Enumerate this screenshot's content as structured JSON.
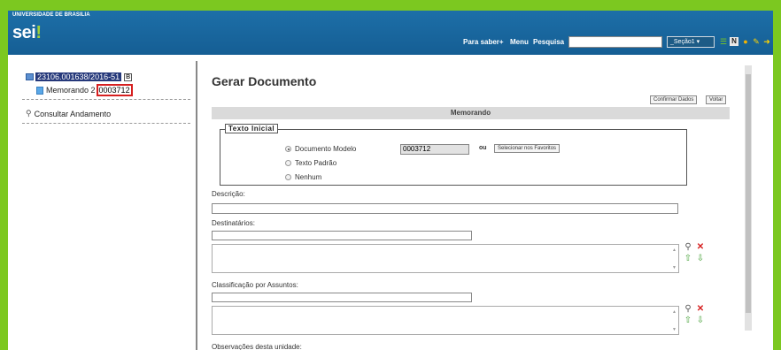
{
  "header": {
    "institution": "UNIVERSIDADE DE BRASILIA",
    "logo_text": "sei",
    "logo_dot": "!",
    "nav": [
      "Para saber+",
      "Menu",
      "Pesquisa"
    ],
    "search_value": "",
    "unit_select": "_Seção1",
    "icons": [
      "list-icon",
      "notification-icon",
      "user-icon",
      "tools-icon",
      "exit-icon"
    ]
  },
  "tree": {
    "process_number": "23106.001638/2016-51",
    "process_badge": "B",
    "document_label": "Memorando 2",
    "document_number": "0003712",
    "consult_label": "Consultar Andamento"
  },
  "page": {
    "title": "Gerar Documento",
    "confirm_button": "Confirmar Dados",
    "back_button": "Voltar",
    "section_title": "Memorando"
  },
  "initial_text": {
    "legend": "Texto Inicial",
    "options": [
      "Documento Modelo",
      "Texto Padrão",
      "Nenhum"
    ],
    "selected": "Documento Modelo",
    "model_value": "0003712",
    "or_label": "ou",
    "favorites_button": "Selecionar nos Favoritos"
  },
  "fields": {
    "description_label": "Descrição:",
    "description_value": "",
    "recipients_label": "Destinatários:",
    "subjects_label": "Classificação por Assuntos:",
    "notes_label": "Observações desta unidade:"
  },
  "colors": {
    "frame_border": "#7cc820",
    "header_bg": "#1d6fa8",
    "process_highlight": "#25387a",
    "document_outline": "#d62020"
  }
}
